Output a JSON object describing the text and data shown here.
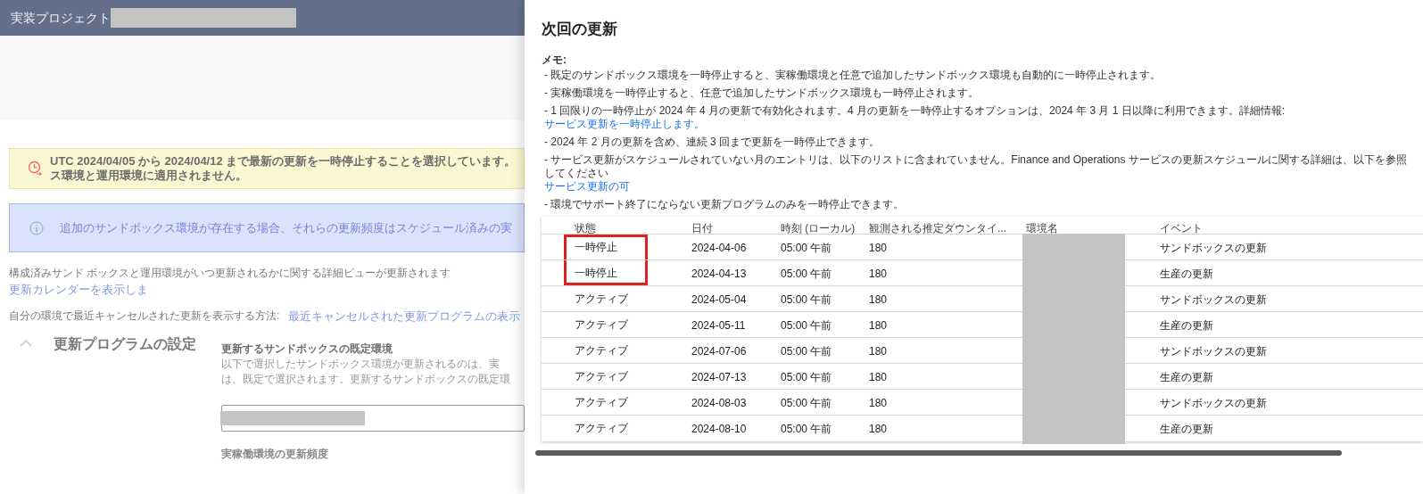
{
  "background_page": {
    "header": {
      "title": "実装プロジェクト"
    },
    "warning": {
      "lines": [
        "UTC 2024/04/05 から 2024/04/12 まで最新の更新を一時停止することを選択しています。",
        "ス環境と運用環境に適用されません。"
      ]
    },
    "info": {
      "text": "追加のサンドボックス環境が存在する場合、それらの更新頻度はスケジュール済みの実"
    },
    "links": [
      {
        "text": "構成済みサンド ボックスと運用環境がいつ更新されるかに関する詳細ビューが更新されます",
        "link": "更新カレンダーを表示しま"
      },
      {
        "text": "自分の環境で最近キャンセルされた更新を表示する方法:",
        "link": "最近キャンセルされた更新プログラムの表示"
      }
    ],
    "section": {
      "title": "更新プログラムの設定",
      "expanded": true,
      "field_label": "更新するサンドボックスの既定環境",
      "description": [
        "以下で選択したサンドボックス環境が更新されるのは、実",
        "は、既定で選択されます。更新するサンドボックスの既定環"
      ],
      "next_label": "実稼働環境の更新頻度"
    }
  },
  "panel": {
    "title": "次回の更新",
    "memo_label": "メモ:",
    "notes": [
      {
        "text": "- 既定のサンドボックス環境を一時停止すると、実稼働環境と任意で追加したサンドボックス環境も自動的に一時停止されます。"
      },
      {
        "text": "- 実稼働環境を一時停止すると、任意で追加したサンドボックス環境も一時停止されます。"
      },
      {
        "text": "- 1 回限りの一時停止が 2024 年 4 月の更新で有効化されます。4 月の更新を一時停止するオプションは、2024 年 3 月 1 日以降に利用できます。詳細情報:",
        "link": "サービス更新を一時停止します。"
      },
      {
        "text": "- 2024 年 2 月の更新を含め、連続 3 回まで更新を一時停止できます。"
      },
      {
        "text": "- サービス更新がスケジュールされていない月のエントリは、以下のリストに含まれていません。Finance and Operations サービスの更新スケジュールに関する詳細は、以下を参照してください",
        "link": "サービス更新の可"
      },
      {
        "text": "- 環境でサポート終了にならない更新プログラムのみを一時停止できます。"
      }
    ],
    "table": {
      "columns": [
        "状態",
        "日付",
        "時刻 (ローカル)",
        "観測される推定ダウンタイ...",
        "環境名",
        "イベント"
      ],
      "rows": [
        {
          "status": "一時停止",
          "highlighted": true,
          "date": "2024-04-06",
          "time": "05:00 午前",
          "downtime": "180",
          "event": "サンドボックスの更新"
        },
        {
          "status": "一時停止",
          "highlighted": true,
          "date": "2024-04-13",
          "time": "05:00 午前",
          "downtime": "180",
          "event": "生産の更新"
        },
        {
          "status": "アクティブ",
          "highlighted": false,
          "date": "2024-05-04",
          "time": "05:00 午前",
          "downtime": "180",
          "event": "サンドボックスの更新"
        },
        {
          "status": "アクティブ",
          "highlighted": false,
          "date": "2024-05-11",
          "time": "05:00 午前",
          "downtime": "180",
          "event": "生産の更新"
        },
        {
          "status": "アクティブ",
          "highlighted": false,
          "date": "2024-07-06",
          "time": "05:00 午前",
          "downtime": "180",
          "event": "サンドボックスの更新"
        },
        {
          "status": "アクティブ",
          "highlighted": false,
          "date": "2024-07-13",
          "time": "05:00 午前",
          "downtime": "180",
          "event": "生産の更新"
        },
        {
          "status": "アクティブ",
          "highlighted": false,
          "date": "2024-08-03",
          "time": "05:00 午前",
          "downtime": "180",
          "event": "サンドボックスの更新"
        },
        {
          "status": "アクティブ",
          "highlighted": false,
          "date": "2024-08-10",
          "time": "05:00 午前",
          "downtime": "180",
          "event": "生産の更新"
        }
      ]
    }
  }
}
